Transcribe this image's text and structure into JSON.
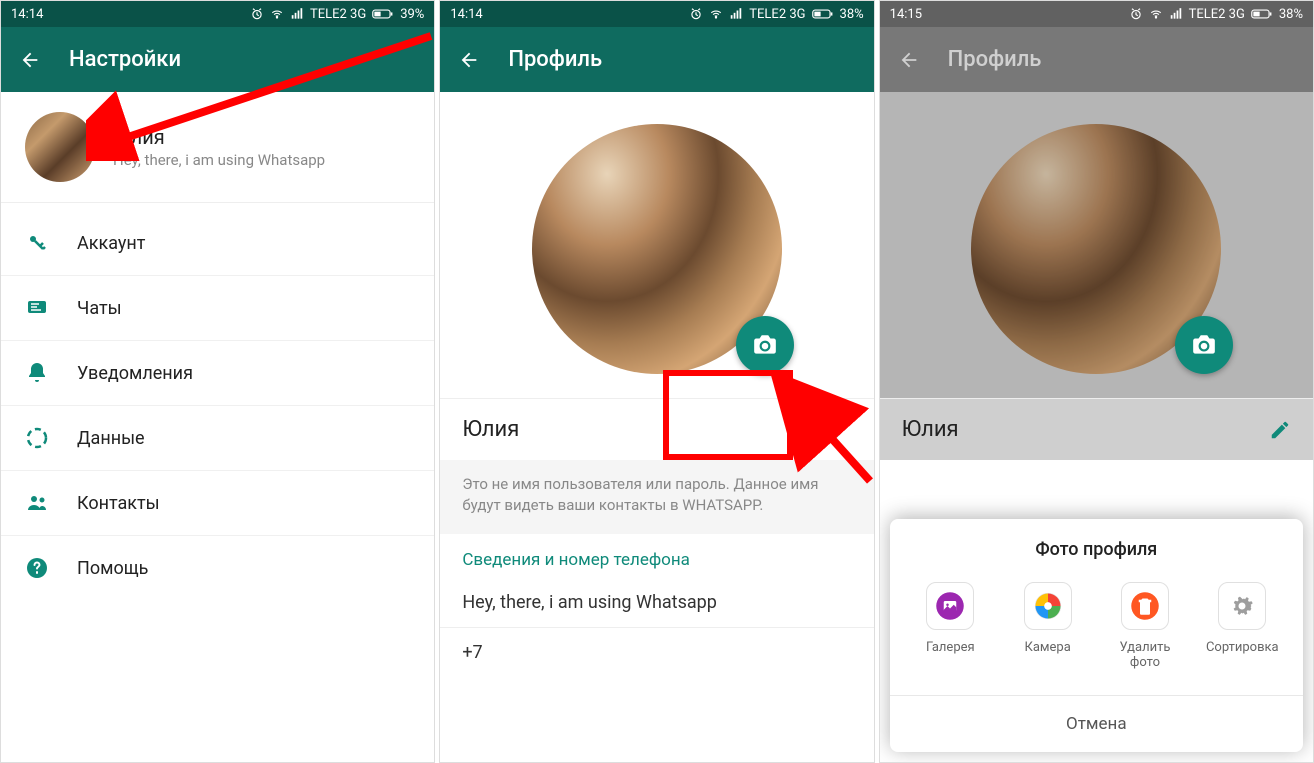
{
  "statusBar": {
    "time1": "14:14",
    "time2": "14:14",
    "time3": "14:15",
    "carrier": "TELE2 3G",
    "battery1": "39%",
    "battery2": "38%",
    "battery3": "38%"
  },
  "colors": {
    "primary": "#0f6b5f",
    "accent": "#0f8a7a",
    "highlight": "#ff0000"
  },
  "screen1": {
    "title": "Настройки",
    "profile": {
      "name": "Юлия",
      "status": "Hey, there, i am using Whatsapp"
    },
    "menu": [
      {
        "icon": "key-icon",
        "label": "Аккаунт"
      },
      {
        "icon": "chat-icon",
        "label": "Чаты"
      },
      {
        "icon": "bell-icon",
        "label": "Уведомления"
      },
      {
        "icon": "data-icon",
        "label": "Данные"
      },
      {
        "icon": "contacts-icon",
        "label": "Контакты"
      },
      {
        "icon": "help-icon",
        "label": "Помощь"
      }
    ]
  },
  "screen2": {
    "title": "Профиль",
    "name": "Юлия",
    "hint": "Это не имя пользователя или пароль. Данное имя будут видеть ваши контакты в WHATSAPP.",
    "sectionTitle": "Сведения и номер телефона",
    "status": "Hey, there, i am using Whatsapp",
    "phone": "+7"
  },
  "screen3": {
    "title": "Профиль",
    "name": "Юлия",
    "sheet": {
      "title": "Фото профиля",
      "options": [
        {
          "icon": "gallery-icon",
          "label": "Галерея"
        },
        {
          "icon": "camera-color-icon",
          "label": "Камера"
        },
        {
          "icon": "delete-icon",
          "label": "Удалить фото"
        },
        {
          "icon": "gear-icon",
          "label": "Сортировка"
        }
      ],
      "cancel": "Отмена"
    }
  }
}
